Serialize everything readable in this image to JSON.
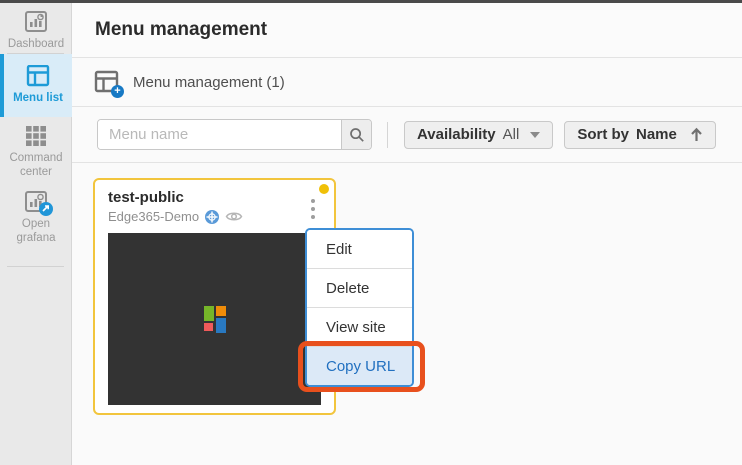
{
  "sidebar": {
    "items": [
      {
        "label": "Dashboard",
        "icon": "dashboard-chart-icon",
        "active": false
      },
      {
        "label": "Menu list",
        "icon": "menu-list-layout-icon",
        "active": true
      },
      {
        "label": "Command center",
        "icon": "command-center-grid-icon",
        "active": false
      },
      {
        "label": "Open grafana",
        "icon": "open-grafana-icon",
        "active": false
      }
    ]
  },
  "header": {
    "title": "Menu management"
  },
  "section": {
    "title": "Menu management (1)",
    "icon": "menu-add-icon",
    "badge": "+"
  },
  "toolbar": {
    "search": {
      "placeholder": "Menu name",
      "value": "",
      "button_icon": "search-icon"
    },
    "availability": {
      "label": "Availability",
      "value": "All",
      "icon": "caret-down-icon"
    },
    "sort": {
      "label": "Sort by",
      "value": "Name",
      "icon": "arrow-up-icon"
    }
  },
  "card": {
    "title": "test-public",
    "subtitle": "Edge365-Demo",
    "icons": [
      "globe-icon",
      "eye-icon",
      "kebab-menu-icon"
    ],
    "status_dot_color": "#f0c008",
    "border_color": "#f2c53d",
    "thumbnail": {
      "background": "#333333",
      "logo_colors": {
        "green": "#76b629",
        "orange": "#ef8c09",
        "red": "#ef5a5a",
        "blue": "#2979c1"
      }
    }
  },
  "context_menu": {
    "border_color": "#3e8ed6",
    "items": [
      {
        "label": "Edit",
        "highlighted": false
      },
      {
        "label": "Delete",
        "highlighted": false
      },
      {
        "label": "View site",
        "highlighted": false
      },
      {
        "label": "Copy URL",
        "highlighted": true
      }
    ],
    "highlight_bg": "#dce9f7",
    "highlight_text_color": "#2170c0"
  },
  "annotation": {
    "shape": "red-box",
    "color": "#e8501d",
    "target": "Copy URL"
  },
  "colors": {
    "accent_blue": "#1e9bd7",
    "sidebar_bg": "#e9e9e9",
    "sidebar_active_bg": "#d9ecf8",
    "main_bg": "#fafafa"
  }
}
